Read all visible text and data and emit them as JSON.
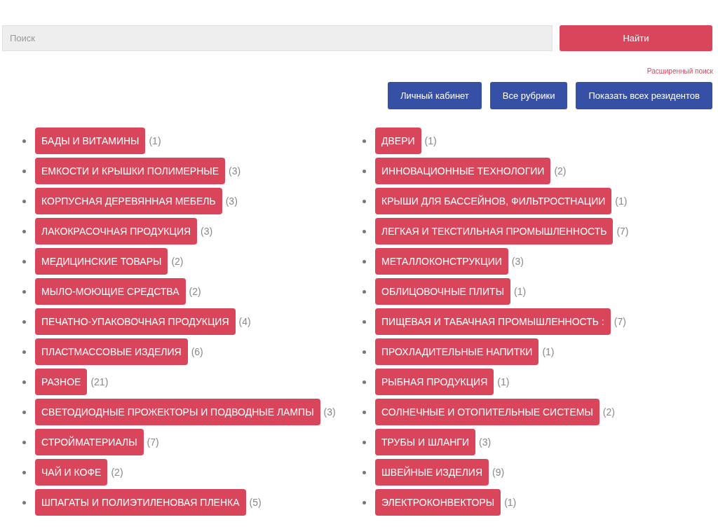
{
  "search": {
    "placeholder": "Поиск",
    "button": "Найти"
  },
  "advanced_search_link": "Расширенный поиск",
  "nav_buttons": [
    "Личный кабинет",
    "Все рубрики",
    "Показать всех резидентов"
  ],
  "categories_left": [
    {
      "label": "БАДЫ И ВИТАМИНЫ",
      "count": "(1)"
    },
    {
      "label": "ЕМКОСТИ И КРЫШКИ ПОЛИМЕРНЫЕ",
      "count": "(3)"
    },
    {
      "label": "КОРПУСНАЯ ДЕРЕВЯННАЯ МЕБЕЛЬ",
      "count": "(3)"
    },
    {
      "label": "ЛАКОКРАСОЧНАЯ ПРОДУКЦИЯ",
      "count": "(3)"
    },
    {
      "label": "МЕДИЦИНСКИЕ ТОВАРЫ",
      "count": "(2)"
    },
    {
      "label": "МЫЛО-МОЮЩИЕ СРЕДСТВА",
      "count": "(2)"
    },
    {
      "label": "ПЕЧАТНО-УПАКОВОЧНАЯ ПРОДУКЦИЯ",
      "count": "(4)"
    },
    {
      "label": "ПЛАСТМАССОВЫЕ ИЗДЕЛИЯ",
      "count": "(6)"
    },
    {
      "label": "РАЗНОЕ",
      "count": "(21)"
    },
    {
      "label": "СВЕТОДИОДНЫЕ ПРОЖЕКТОРЫ И ПОДВОДНЫЕ ЛАМПЫ",
      "count": "(3)"
    },
    {
      "label": "СТРОЙМАТЕРИАЛЫ",
      "count": "(7)"
    },
    {
      "label": "ЧАЙ И КОФЕ",
      "count": "(2)"
    },
    {
      "label": "ШПАГАТЫ И ПОЛИЭТИЛЕНОВАЯ ПЛЕНКА",
      "count": "(5)"
    }
  ],
  "categories_right": [
    {
      "label": "ДВЕРИ",
      "count": "(1)"
    },
    {
      "label": "ИННОВАЦИОННЫЕ ТЕХНОЛОГИИ",
      "count": "(2)"
    },
    {
      "label": "КРЫШИ ДЛЯ БАССЕЙНОВ, ФИЛЬТРОСТНАЦИИ",
      "count": "(1)"
    },
    {
      "label": "ЛЕГКАЯ И ТЕКСТИЛЬНАЯ ПРОМЫШЛЕННОСТЬ",
      "count": "(7)"
    },
    {
      "label": "МЕТАЛЛОКОНСТРУКЦИИ",
      "count": "(3)"
    },
    {
      "label": "ОБЛИЦОВОЧНЫЕ ПЛИТЫ",
      "count": "(1)"
    },
    {
      "label": "ПИЩЕВАЯ И ТАБАЧНАЯ ПРОМЫШЛЕННОСТЬ :",
      "count": "(7)"
    },
    {
      "label": "ПРОХЛАДИТЕЛЬНЫЕ НАПИТКИ",
      "count": "(1)"
    },
    {
      "label": "РЫБНАЯ ПРОДУКЦИЯ",
      "count": "(1)"
    },
    {
      "label": "СОЛНЕЧНЫЕ И ОТОПИТЕЛЬНЫЕ СИСТЕМЫ",
      "count": "(2)"
    },
    {
      "label": "ТРУБЫ И ШЛАНГИ",
      "count": "(3)"
    },
    {
      "label": "ШВЕЙНЫЕ ИЗДЕЛИЯ",
      "count": "(9)"
    },
    {
      "label": "ЭЛЕКТРОКОНВЕКТОРЫ",
      "count": "(1)"
    }
  ]
}
